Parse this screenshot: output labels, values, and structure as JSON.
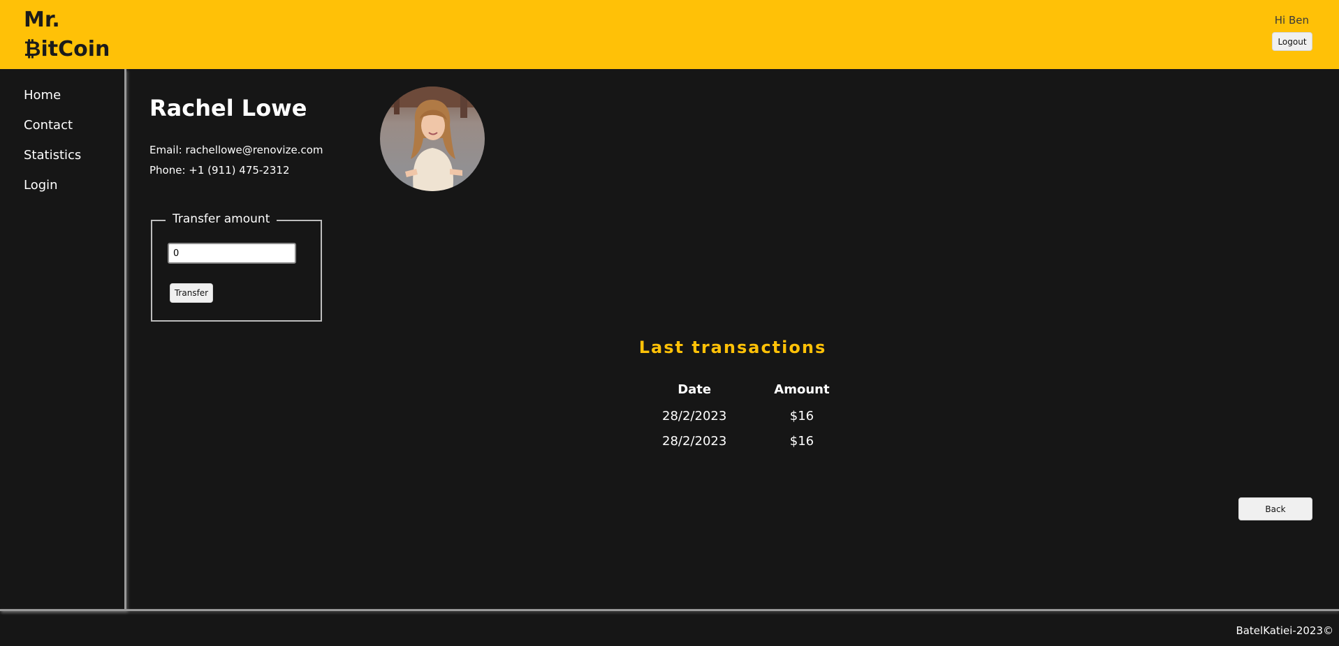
{
  "header": {
    "logo_line1": "Mr.",
    "logo_line2": "₿itCoin",
    "greeting": "Hi Ben",
    "logout_label": "Logout",
    "background_color": "#ffc107"
  },
  "sidebar": {
    "items": [
      {
        "label": "Home"
      },
      {
        "label": "Contact"
      },
      {
        "label": "Statistics"
      },
      {
        "label": "Login"
      }
    ]
  },
  "contact": {
    "name": "Rachel Lowe",
    "email_line": "Email: rachellowe@renovize.com",
    "phone_line": "Phone: +1 (911) 475-2312",
    "avatar_icon": "user-photo"
  },
  "transfer": {
    "legend": "Transfer amount",
    "amount_value": "0",
    "button_label": "Transfer"
  },
  "transactions": {
    "title": "Last transactions",
    "columns": [
      "Date",
      "Amount"
    ],
    "rows": [
      {
        "date": "28/2/2023",
        "amount": "$16"
      },
      {
        "date": "28/2/2023",
        "amount": "$16"
      }
    ],
    "title_color": "#ffc107"
  },
  "back_label": "Back",
  "footer": {
    "text": "BatelKatiei-2023©"
  }
}
